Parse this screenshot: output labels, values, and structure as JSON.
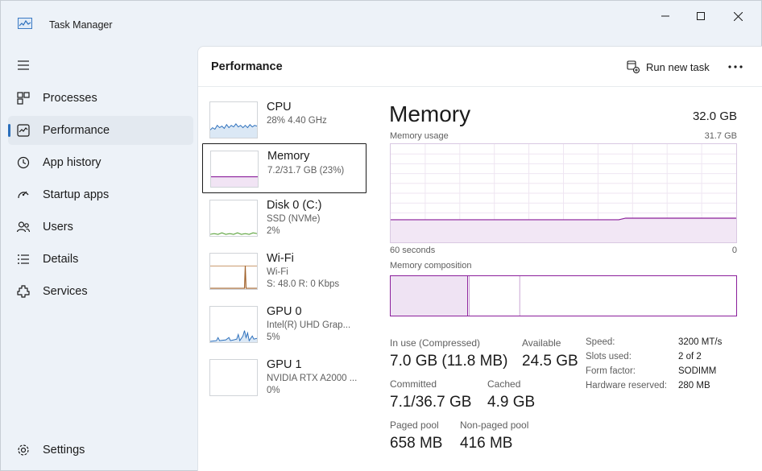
{
  "window": {
    "title": "Task Manager",
    "accent": "#2a6ebb",
    "memory_color": "#8b1f9b"
  },
  "sidebar": {
    "items": [
      {
        "label": "Processes",
        "icon": "processes-icon"
      },
      {
        "label": "Performance",
        "icon": "performance-icon",
        "active": true
      },
      {
        "label": "App history",
        "icon": "history-icon"
      },
      {
        "label": "Startup apps",
        "icon": "startup-icon"
      },
      {
        "label": "Users",
        "icon": "users-icon"
      },
      {
        "label": "Details",
        "icon": "details-icon"
      },
      {
        "label": "Services",
        "icon": "services-icon"
      }
    ],
    "settings_label": "Settings"
  },
  "header": {
    "title": "Performance",
    "run_new_task": "Run new task"
  },
  "devices": [
    {
      "name": "CPU",
      "line1": "28%  4.40 GHz",
      "line2": ""
    },
    {
      "name": "Memory",
      "line1": "7.2/31.7 GB (23%)",
      "line2": "",
      "selected": true
    },
    {
      "name": "Disk 0 (C:)",
      "line1": "SSD (NVMe)",
      "line2": "2%"
    },
    {
      "name": "Wi-Fi",
      "line1": "Wi-Fi",
      "line2": "S: 48.0  R: 0 Kbps"
    },
    {
      "name": "GPU 0",
      "line1": "Intel(R) UHD Grap...",
      "line2": "5%"
    },
    {
      "name": "GPU 1",
      "line1": "NVIDIA RTX A2000 ...",
      "line2": "0%"
    }
  ],
  "detail": {
    "title": "Memory",
    "total": "32.0 GB",
    "usage_label": "Memory usage",
    "usage_max": "31.7 GB",
    "time_label": "60 seconds",
    "time_end": "0",
    "usage_fraction": 0.23,
    "composition_label": "Memory composition",
    "stats": {
      "in_use_label": "In use (Compressed)",
      "in_use_value": "7.0 GB (11.8 MB)",
      "available_label": "Available",
      "available_value": "24.5 GB",
      "committed_label": "Committed",
      "committed_value": "7.1/36.7 GB",
      "cached_label": "Cached",
      "cached_value": "4.9 GB",
      "paged_label": "Paged pool",
      "paged_value": "658 MB",
      "nonpaged_label": "Non-paged pool",
      "nonpaged_value": "416 MB"
    },
    "specs": [
      {
        "key": "Speed:",
        "value": "3200 MT/s"
      },
      {
        "key": "Slots used:",
        "value": "2 of 2"
      },
      {
        "key": "Form factor:",
        "value": "SODIMM"
      },
      {
        "key": "Hardware reserved:",
        "value": "280 MB"
      }
    ]
  }
}
